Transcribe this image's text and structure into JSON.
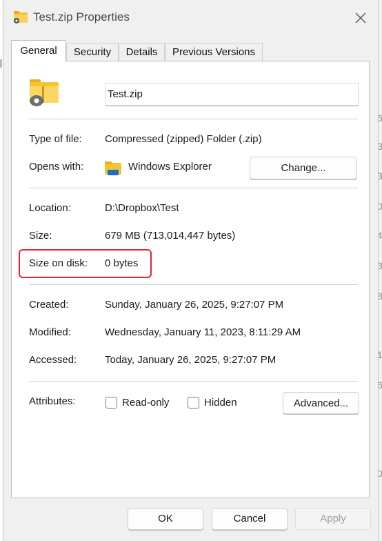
{
  "window": {
    "title": "Test.zip Properties"
  },
  "tabs": [
    {
      "label": "General"
    },
    {
      "label": "Security"
    },
    {
      "label": "Details"
    },
    {
      "label": "Previous Versions"
    }
  ],
  "file": {
    "name": "Test.zip"
  },
  "type_of_file": {
    "label": "Type of file:",
    "value": "Compressed (zipped) Folder (.zip)"
  },
  "opens_with": {
    "label": "Opens with:",
    "value": "Windows Explorer",
    "change_label": "Change..."
  },
  "location": {
    "label": "Location:",
    "value": "D:\\Dropbox\\Test"
  },
  "size": {
    "label": "Size:",
    "value": "679 MB (713,014,447 bytes)"
  },
  "size_on_disk": {
    "label": "Size on disk:",
    "value": "0 bytes"
  },
  "created": {
    "label": "Created:",
    "value": "Sunday, January 26, 2025, 9:27:07 PM"
  },
  "modified": {
    "label": "Modified:",
    "value": "Wednesday, January 11, 2023, 8:11:29 AM"
  },
  "accessed": {
    "label": "Accessed:",
    "value": "Today, January 26, 2025, 9:27:07 PM"
  },
  "attributes": {
    "label": "Attributes:",
    "readonly_label": "Read-only",
    "readonly_checked": false,
    "hidden_label": "Hidden",
    "hidden_checked": false,
    "advanced_label": "Advanced..."
  },
  "footer": {
    "ok_label": "OK",
    "cancel_label": "Cancel",
    "apply_label": "Apply"
  },
  "background_digits": [
    "6",
    "3",
    "3",
    "0",
    "4",
    "3",
    "8",
    "1",
    "6",
    "0"
  ],
  "colors": {
    "highlight": "#e0262a",
    "folder": "#f5c333",
    "dialog_bg": "#f0f0f0"
  }
}
